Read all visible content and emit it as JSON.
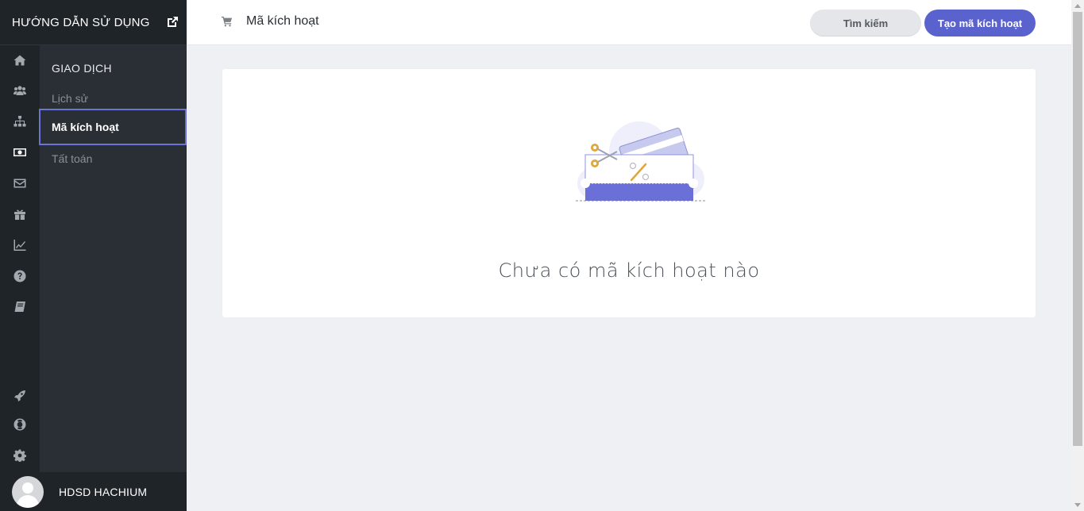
{
  "brand": {
    "title": "HƯỚNG DẪN SỬ DỤNG",
    "external_icon": "external-link-icon"
  },
  "rail": {
    "icons": [
      {
        "name": "home-icon"
      },
      {
        "name": "users-icon"
      },
      {
        "name": "sitemap-icon"
      },
      {
        "name": "money-icon",
        "active": true
      },
      {
        "name": "envelope-icon"
      },
      {
        "name": "gift-icon"
      },
      {
        "name": "line-chart-icon"
      },
      {
        "name": "help-icon"
      },
      {
        "name": "book-icon"
      },
      {
        "name": "rocket-icon"
      },
      {
        "name": "lifebuoy-icon"
      },
      {
        "name": "gear-icon"
      }
    ]
  },
  "submenu": {
    "heading": "GIAO DỊCH",
    "items": [
      {
        "label": "Lịch sử",
        "active": false
      },
      {
        "label": "Mã kích hoạt",
        "active": true
      },
      {
        "label": "Tất toán",
        "active": false
      }
    ]
  },
  "user": {
    "name": "HDSD HACHIUM"
  },
  "header": {
    "icon": "cart-icon",
    "title": "Mã kích hoạt",
    "search_label": "Tìm kiếm",
    "create_label": "Tạo mã kích hoạt"
  },
  "empty_state": {
    "message": "Chưa có mã kích hoạt nào"
  },
  "colors": {
    "accent": "#5a62cd",
    "sidebar": "#1f2429",
    "submenu": "#2a2f35",
    "background": "#eef0f4"
  }
}
